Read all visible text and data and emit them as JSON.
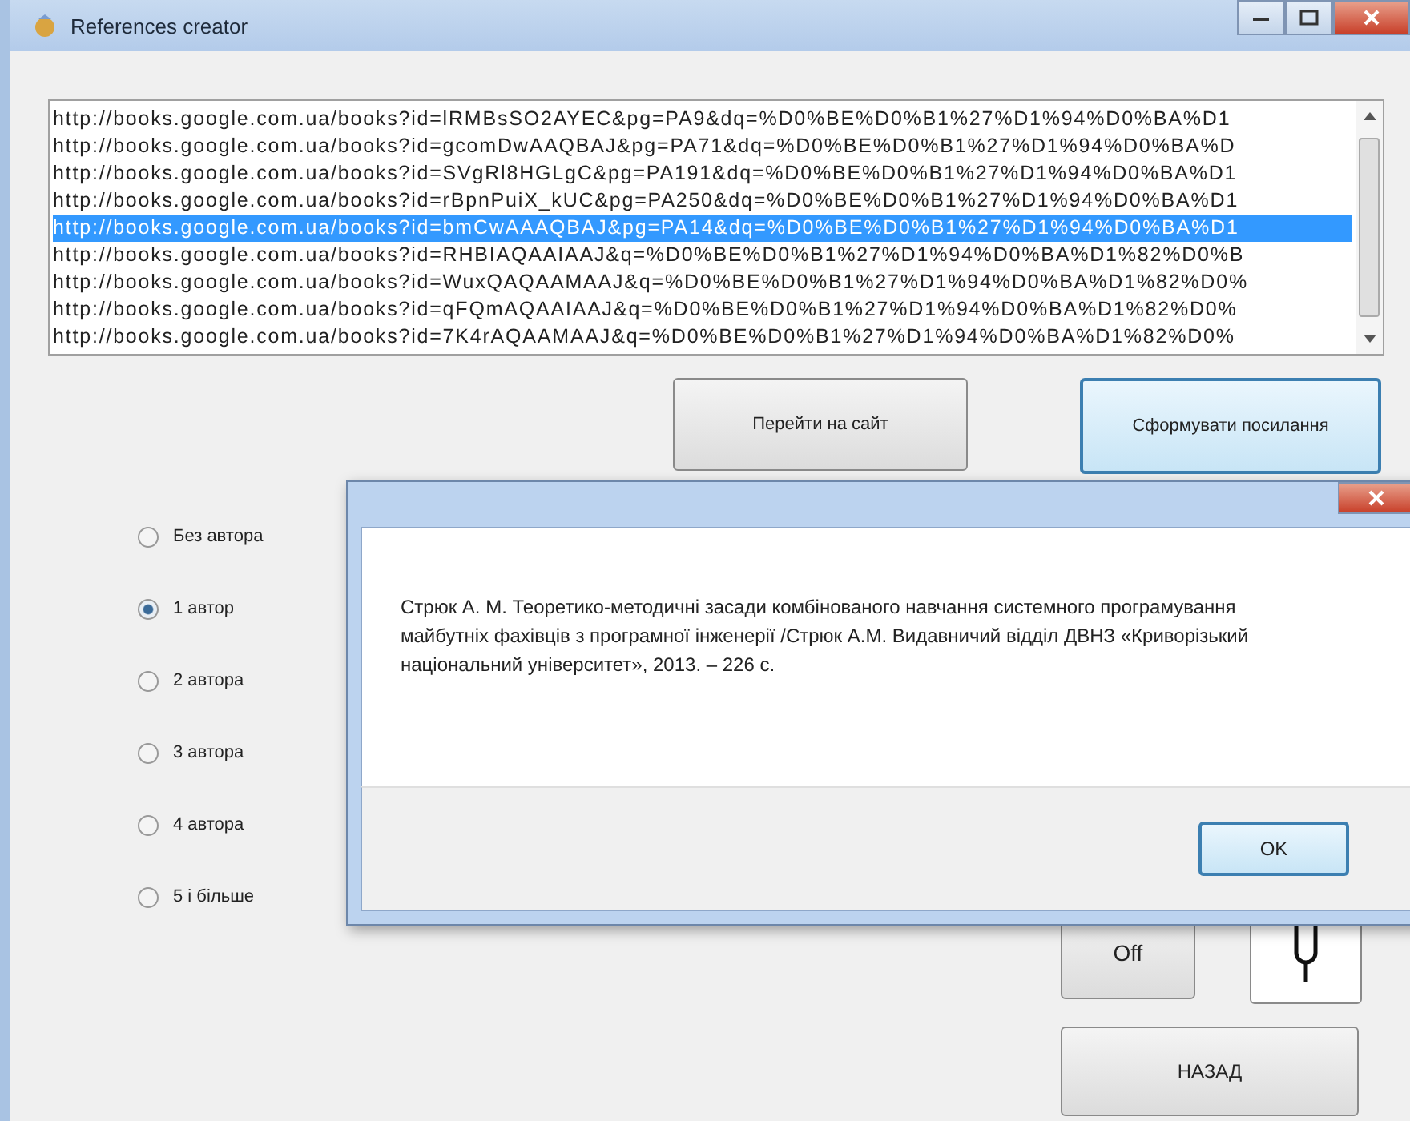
{
  "window": {
    "title": "References creator"
  },
  "urls": [
    {
      "text": "http://books.google.com.ua/books?id=lRMBsSO2AYEC&pg=PA9&dq=%D0%BE%D0%B1%27%D1%94%D0%BA%D1",
      "selected": false
    },
    {
      "text": "http://books.google.com.ua/books?id=gcomDwAAQBAJ&pg=PA71&dq=%D0%BE%D0%B1%27%D1%94%D0%BA%D",
      "selected": false
    },
    {
      "text": "http://books.google.com.ua/books?id=SVgRl8HGLgC&pg=PA191&dq=%D0%BE%D0%B1%27%D1%94%D0%BA%D1",
      "selected": false
    },
    {
      "text": "http://books.google.com.ua/books?id=rBpnPuiX_kUC&pg=PA250&dq=%D0%BE%D0%B1%27%D1%94%D0%BA%D1",
      "selected": false
    },
    {
      "text": "http://books.google.com.ua/books?id=bmCwAAAQBAJ&pg=PA14&dq=%D0%BE%D0%B1%27%D1%94%D0%BA%D1",
      "selected": true
    },
    {
      "text": "http://books.google.com.ua/books?id=RHBIAQAAIAAJ&q=%D0%BE%D0%B1%27%D1%94%D0%BA%D1%82%D0%B",
      "selected": false
    },
    {
      "text": "http://books.google.com.ua/books?id=WuxQAQAAMAAJ&q=%D0%BE%D0%B1%27%D1%94%D0%BA%D1%82%D0%",
      "selected": false
    },
    {
      "text": "http://books.google.com.ua/books?id=qFQmAQAAIAAJ&q=%D0%BE%D0%B1%27%D1%94%D0%BA%D1%82%D0%",
      "selected": false
    },
    {
      "text": "http://books.google.com.ua/books?id=7K4rAQAAMAAJ&q=%D0%BE%D0%B1%27%D1%94%D0%BA%D1%82%D0%",
      "selected": false
    }
  ],
  "buttons": [
    {
      "label": "Перейти на сайт"
    },
    {
      "label": "Сформувати посилання"
    }
  ],
  "author_options": [
    {
      "label": "Без автора",
      "selected": false
    },
    {
      "label": "1 автор",
      "selected": true
    },
    {
      "label": "2 автора",
      "selected": false
    },
    {
      "label": "3 автора",
      "selected": false
    },
    {
      "label": "4 автора",
      "selected": false
    },
    {
      "label": "5 і більше",
      "selected": false
    }
  ],
  "off_button": {
    "label": "Off"
  },
  "back_button": {
    "label": "НАЗАД"
  },
  "dialog": {
    "message": "Стрюк А. М. Теоретико-методичні засади комбінованого навчання системного програмування майбутніх фахівців з програмної інженерії /Стрюк А.М. Видавничий відділ ДВНЗ «Криворізький національний університет», 2013. – 226 с.",
    "ok": "OK"
  }
}
